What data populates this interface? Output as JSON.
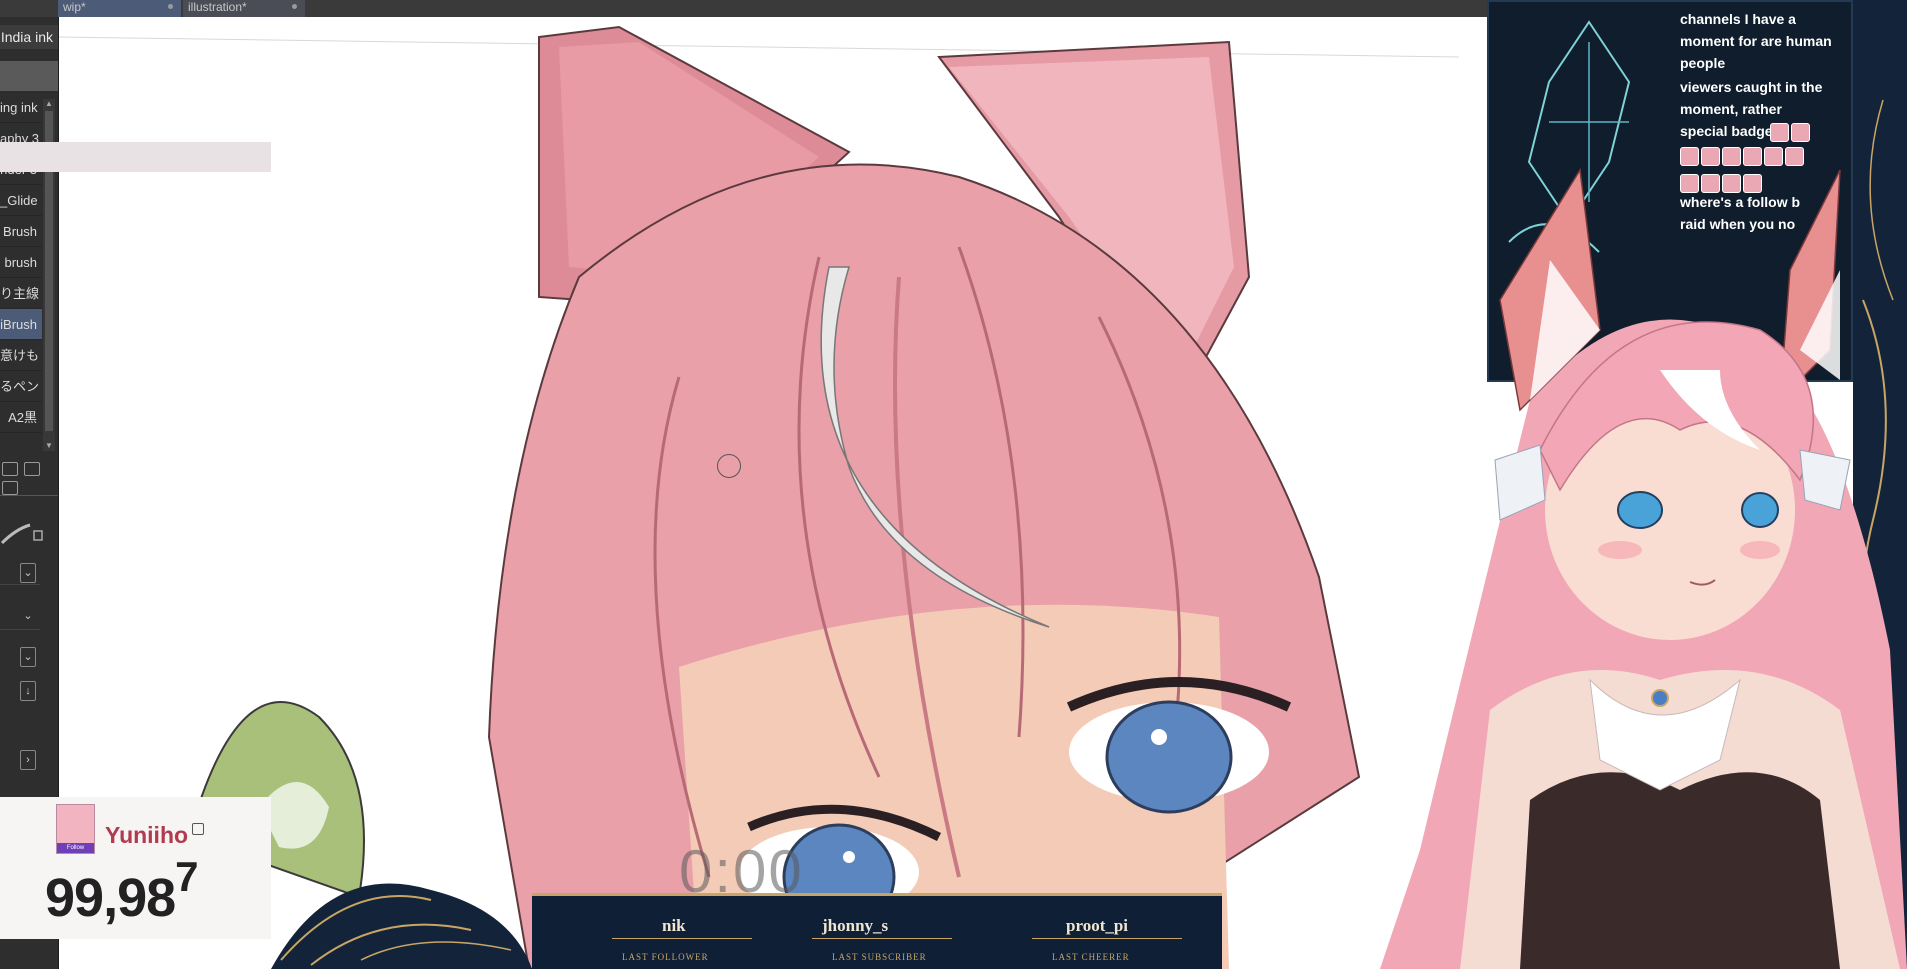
{
  "tabs": [
    {
      "label": "wip*"
    },
    {
      "label": "illustration*"
    }
  ],
  "brush_panel": {
    "header": "India ink",
    "items": [
      {
        "label": "ing ink"
      },
      {
        "label": "aphy 3"
      },
      {
        "label": "nder 3"
      },
      {
        "label": "_Glide"
      },
      {
        "label": "Brush"
      },
      {
        "label": "brush"
      },
      {
        "label": "り主線"
      },
      {
        "label": "iBrush"
      },
      {
        "label": "意けも"
      },
      {
        "label": "るペン"
      },
      {
        "label": "A2黒"
      }
    ],
    "selected_index": 7
  },
  "chat": {
    "lines": [
      "channels I have a",
      "moment for are human",
      "people",
      "viewers caught in the",
      "moment, rather",
      "special badge",
      "where's a follow b",
      "raid when you no"
    ]
  },
  "canvas": {
    "timer_text": "0:00"
  },
  "goal_widget": {
    "follow_label": "Follow",
    "name": "Yuniiho",
    "count_main": "99,98",
    "count_last": "7"
  },
  "bottom_bar": {
    "items": [
      {
        "name": "nik",
        "tag": "LAST FOLLOWER"
      },
      {
        "name": "jhonny_s",
        "tag": "LAST SUBSCRIBER"
      },
      {
        "name": "proot_pi",
        "tag": "LAST CHEERER"
      }
    ]
  },
  "colors": {
    "hair": "#e9a0a8",
    "hair_shadow": "#c97a84",
    "eye": "#5b86c0",
    "frame_navy": "#0f2036",
    "gold": "#c8a566",
    "panel_dark": "#2e2e2e",
    "selection_blue": "#4b5b78"
  }
}
